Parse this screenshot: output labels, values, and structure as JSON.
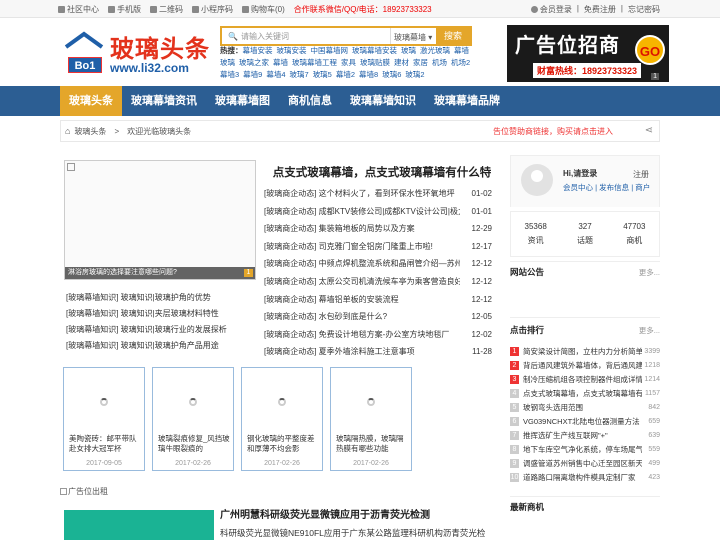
{
  "topbar": {
    "links": [
      "社区中心",
      "手机版",
      "二维码",
      "小程序码",
      "购物车(0)"
    ],
    "contact": "合作联系微信/QQ/电话：18923733323",
    "right": [
      "会员登录",
      "免费注册",
      "忘记密码"
    ],
    "sep": "|"
  },
  "logo": {
    "name": "玻璃头条",
    "url": "www.li32.com",
    "badge": "Bo1"
  },
  "search": {
    "placeholder": "请输入关键词",
    "select": "玻璃幕墙",
    "button": "搜索"
  },
  "hot": {
    "label": "热搜：",
    "items": [
      "幕墙安装",
      "玻璃安装",
      "中国幕墙网",
      "玻璃幕墙安装",
      "玻璃",
      "激光玻璃",
      "幕墙玻璃",
      "玻璃之家",
      "幕墙",
      "玻璃幕墙工程",
      "家具",
      "玻璃贴膜",
      "建材",
      "家居",
      "机场",
      "机场2",
      "幕墙3",
      "幕墙9",
      "幕墙4",
      "玻璃7",
      "玻璃5",
      "幕墙2",
      "幕墙8",
      "玻璃6",
      "玻璃2"
    ]
  },
  "ad": {
    "title": "广告位招商",
    "go": "GO",
    "hotline": "财富热线：18923733323",
    "close": "1"
  },
  "nav": [
    "玻璃头条",
    "玻璃幕墙资讯",
    "玻璃幕墙图",
    "商机信息",
    "玻璃幕墙知识",
    "玻璃幕墙品牌"
  ],
  "crumb": {
    "home": "玻璃头条",
    "sep": ">",
    "current": "欢迎光临玻璃头条",
    "notice": "告位赞助商链接，购买请点击进入"
  },
  "focus": {
    "caption": "淋浴房玻璃的选择要注意哪些问题?",
    "num": "1"
  },
  "left_list": [
    "[玻璃幕墙知识] 玻璃知识|玻璃护角的优势",
    "[玻璃幕墙知识] 玻璃知识|夹层玻璃材料特性",
    "[玻璃幕墙知识] 玻璃知识|玻璃行业的发展探析",
    "[玻璃幕墙知识] 玻璃知识|玻璃护角产品用途"
  ],
  "headline": "点支式玻璃幕墙，点支式玻璃幕墙有什么特",
  "news": [
    {
      "t": "[玻璃商企动态] 这个材料火了，看到环保水性环氧地坪",
      "d": "01-02"
    },
    {
      "t": "[玻璃商企动态] 成都KTV装修公司|成都KTV设计公司|极力",
      "d": "01-01"
    },
    {
      "t": "[玻璃商企动态] 集装箱地板的局势以及方案",
      "d": "12-29"
    },
    {
      "t": "[玻璃商企动态] 司克雅门窗全铝房门隆重上市啦!",
      "d": "12-17"
    },
    {
      "t": "[玻璃商企动态] 中频点焊机整流系统和晶闸管介绍—苏州",
      "d": "12-12"
    },
    {
      "t": "[玻璃商企动态] 太原公交司机清洗候车亭为乘客营造良好",
      "d": "12-12"
    },
    {
      "t": "[玻璃商企动态] 幕墙铝单板的安装流程",
      "d": "12-12"
    },
    {
      "t": "[玻璃商企动态] 水包砂到底是什么?",
      "d": "12-05"
    },
    {
      "t": "[玻璃商企动态] 免费设计地毯方案-办公室方块地毯厂",
      "d": "12-02"
    },
    {
      "t": "[玻璃商企动态] 夏季外墙涂料施工注意事项",
      "d": "11-28"
    }
  ],
  "cards": [
    {
      "t": "美陶瓷砖：邮平带队赴女排大冠军杯",
      "d": "2017-09-05"
    },
    {
      "t": "玻璃裂痕修复_风挡玻璃牛眼裂痕的",
      "d": "2017-02-26"
    },
    {
      "t": "钢化玻璃的平整度差和厚薄不均会影",
      "d": "2017-02-26"
    },
    {
      "t": "玻璃隔热膜，玻璃隔热膜有哪些功能",
      "d": "2017-02-26"
    }
  ],
  "adbar": "广告位出租",
  "article2": {
    "title": "广州明慧科研级荧光显微镜应用于沥青荧光检测",
    "desc": "科研级荧光显微镜NE910FL应用于广东某公路监理科研机构沥青荧光检"
  },
  "user": {
    "hi": "Hi,请登录",
    "register": "注册",
    "links": "会员中心 | 发布信息 | 商户"
  },
  "stats": [
    {
      "v": "35368",
      "l": "资讯"
    },
    {
      "v": "327",
      "l": "话题"
    },
    {
      "v": "47703",
      "l": "商机"
    }
  ],
  "site_notice": {
    "title": "网站公告",
    "more": "更多..."
  },
  "rank": {
    "title": "点击排行",
    "more": "更多...",
    "items": [
      {
        "t": "简安梁设计简图，立柱内力分析简单",
        "c": "3399"
      },
      {
        "t": "背后通风建筑外幕墙体，背后通风建",
        "c": "1218"
      },
      {
        "t": "制冷压缩机组各项控制器件组成详情",
        "c": "1214"
      },
      {
        "t": "点支式玻璃幕墙，点支式玻璃幕墙有",
        "c": "1157"
      },
      {
        "t": "玻钢弯头选用范围",
        "c": "842"
      },
      {
        "t": "VG039NCHXT北陆电位器测量方法",
        "c": "659"
      },
      {
        "t": "推挥选矿生产线互联网\"+\"",
        "c": "639"
      },
      {
        "t": "地下车库空气净化系统，停车场尾气",
        "c": "559"
      },
      {
        "t": "调盛管道苏州销售中心迁至园区新天",
        "c": "499"
      },
      {
        "t": "道路路口隔离墩构件模具定制厂家",
        "c": "423"
      }
    ]
  },
  "new_biz": {
    "title": "最新商机"
  },
  "colors": {
    "nav": "#2c5e93",
    "accent": "#e4a62a",
    "red": "#e33"
  }
}
